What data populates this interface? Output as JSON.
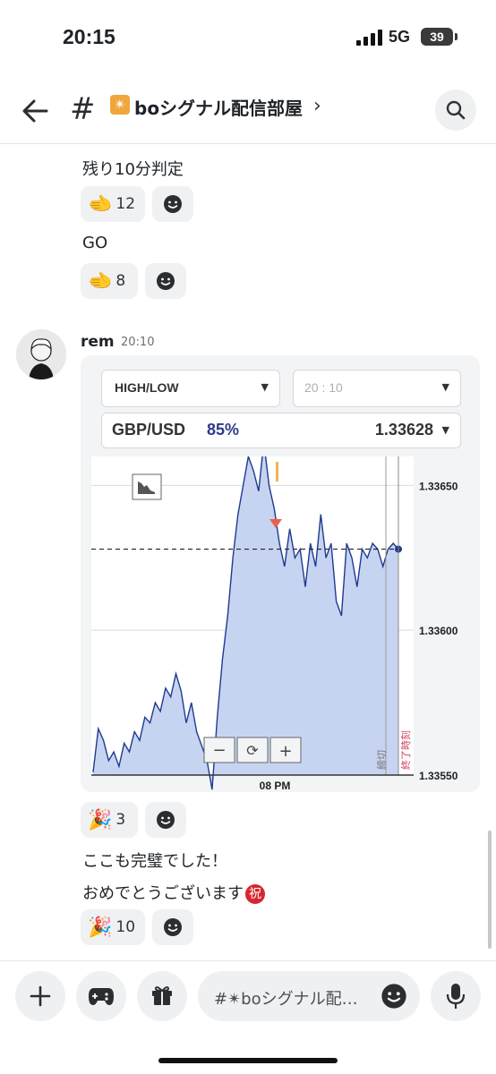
{
  "status_bar": {
    "time": "20:15",
    "network": "5G",
    "battery": "39"
  },
  "header": {
    "channel_hash": "#",
    "channel_name": "boシグナル配信部屋",
    "chevron": "›",
    "burst_icon": "✴"
  },
  "messages_top": [
    {
      "text": "残り10分判定",
      "reaction_emoji": "🫲",
      "reaction_count": "12"
    },
    {
      "text": "GO",
      "reaction_emoji": "🫲",
      "reaction_count": "8"
    }
  ],
  "post": {
    "author": "rem",
    "time": "20:10",
    "card": {
      "trade_type": "HIGH/LOW",
      "expiry": "20 : 10",
      "pair": "GBP/USD",
      "payout": "85%",
      "rate": "1.33628",
      "chart_data": {
        "type": "area",
        "y_ticks": [
          "1.33650",
          "1.33600",
          "1.33550"
        ],
        "x_tick": "08 PM",
        "close_label": "締切",
        "end_label": "終了時刻",
        "ylim": [
          1.3355,
          1.3366
        ],
        "current_value": 1.33628,
        "series": [
          1.33551,
          1.33566,
          1.33562,
          1.33555,
          1.33558,
          1.33553,
          1.33561,
          1.33558,
          1.33565,
          1.33562,
          1.3357,
          1.33568,
          1.33575,
          1.33572,
          1.3358,
          1.33577,
          1.33585,
          1.33579,
          1.33568,
          1.33575,
          1.33565,
          1.3356,
          1.33555,
          1.33545,
          1.3357,
          1.3359,
          1.33605,
          1.33625,
          1.3364,
          1.3365,
          1.3366,
          1.33655,
          1.33648,
          1.33665,
          1.3365,
          1.33642,
          1.3363,
          1.33622,
          1.33635,
          1.33625,
          1.33628,
          1.33615,
          1.3363,
          1.33622,
          1.3364,
          1.33625,
          1.3363,
          1.3361,
          1.33605,
          1.3363,
          1.33625,
          1.33615,
          1.33628,
          1.33625,
          1.3363,
          1.33628,
          1.33622,
          1.33628,
          1.3363,
          1.33628
        ]
      },
      "zoom_out": "−",
      "reset": "⟳",
      "zoom_in": "+"
    },
    "reaction_emoji": "🎉",
    "reaction_count": "3"
  },
  "messages_bottom": {
    "line1": "ここも完璧でした！",
    "line2": "おめでとうございます",
    "iwai": "祝",
    "reaction_emoji": "🎉",
    "reaction_count": "10"
  },
  "composer": {
    "placeholder": "#✴boシグナル配…"
  },
  "colors": {
    "accent": "#2e3a8c",
    "area_fill": "#c7d4f1",
    "line": "#1f3a8f",
    "marker": "#e8604f"
  }
}
